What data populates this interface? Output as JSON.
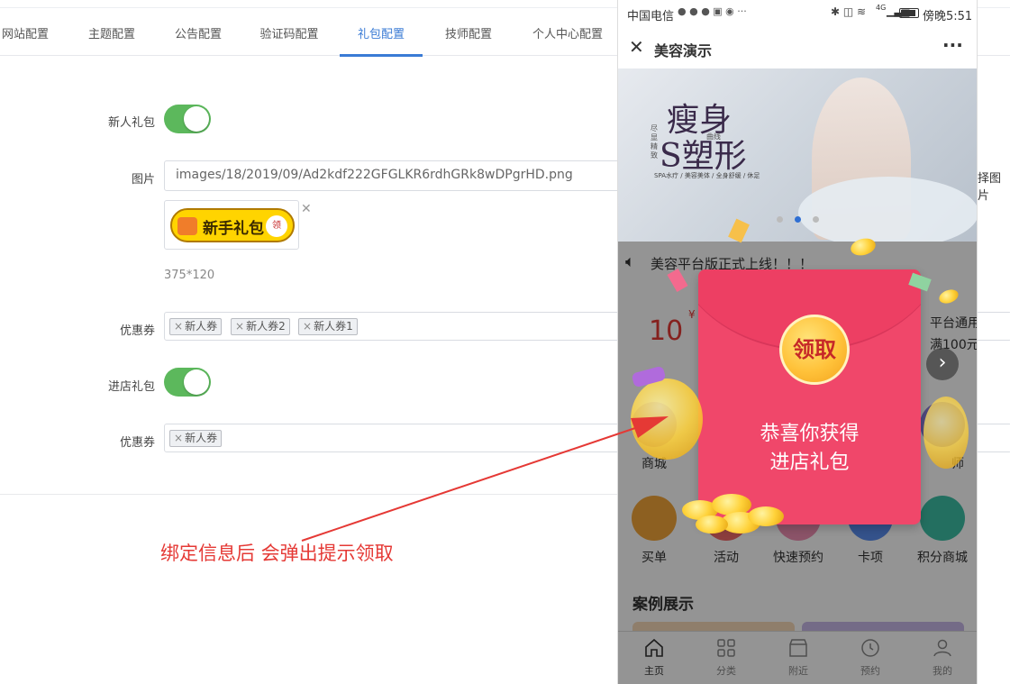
{
  "admin": {
    "tabs": [
      "网站配置",
      "主题配置",
      "公告配置",
      "验证码配置",
      "礼包配置",
      "技师配置",
      "个人中心配置"
    ],
    "active_tab": "礼包配置",
    "form": {
      "new_user_gift_label": "新人礼包",
      "image_label": "图片",
      "image_path": "images/18/2019/09/Ad2kdf222GFGLKR6rdhGRk8wDPgrHD.png",
      "image_size_hint": "375*120",
      "image_preview_text": "新手礼包",
      "image_preview_badge": "领",
      "select_image_text": "择图片",
      "coupon_label": "优惠券",
      "coupons_new_user": [
        "新人券",
        "新人券2",
        "新人券1"
      ],
      "store_gift_label": "进店礼包",
      "coupon_label_2": "优惠券",
      "coupons_store": [
        "新人券"
      ]
    },
    "annotation": "绑定信息后  会弹出提示领取",
    "colors": {
      "accent": "#3a7bd5",
      "toggle_on": "#5cb85c",
      "annotation": "#e53935"
    }
  },
  "phone": {
    "status_bar": {
      "carrier": "中国电信",
      "time": "傍晚5:51",
      "network": "4G"
    },
    "nav": {
      "title": "美容演示",
      "close_icon": "close-icon",
      "more": "···"
    },
    "banner": {
      "title_line1": "瘦身",
      "title_line2": "S塑形",
      "side_text": "尽显精致",
      "sub_text": "曲线",
      "caption": "SPA水疗 / 美容美体 / 全身舒缓 / 休足"
    },
    "notice": "美容平台版正式上线！！！",
    "coupon_strip": {
      "amount": "10",
      "currency": "¥",
      "right_title": "平台通用",
      "right_sub": "满100元"
    },
    "icons_row1": [
      {
        "label": "商城"
      },
      {
        "label": "师"
      }
    ],
    "icons_row2": [
      {
        "label": "买单"
      },
      {
        "label": "活动"
      },
      {
        "label": "快速预约"
      },
      {
        "label": "卡项"
      },
      {
        "label": "积分商城"
      }
    ],
    "section_title": "案例展示",
    "tabbar": [
      {
        "label": "主页"
      },
      {
        "label": "分类"
      },
      {
        "label": "附近"
      },
      {
        "label": "预约"
      },
      {
        "label": "我的"
      }
    ],
    "red_packet": {
      "button": "领取",
      "line1": "恭喜你获得",
      "line2": "进店礼包"
    }
  }
}
